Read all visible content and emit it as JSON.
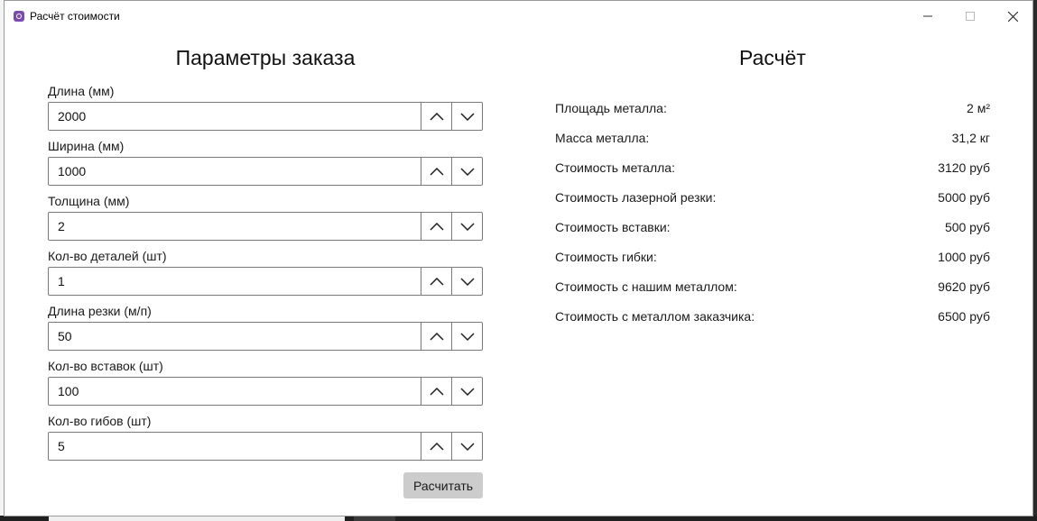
{
  "window": {
    "title": "Расчёт стоимости"
  },
  "params": {
    "heading": "Параметры заказа",
    "fields": [
      {
        "label": "Длина (мм)",
        "value": "2000"
      },
      {
        "label": "Ширина (мм)",
        "value": "1000"
      },
      {
        "label": "Толщина (мм)",
        "value": "2"
      },
      {
        "label": "Кол-во деталей (шт)",
        "value": "1"
      },
      {
        "label": "Длина резки (м/п)",
        "value": "50"
      },
      {
        "label": "Кол-во вставок (шт)",
        "value": "100"
      },
      {
        "label": "Кол-во гибов (шт)",
        "value": "5"
      }
    ],
    "calculate_label": "Расчитать"
  },
  "results": {
    "heading": "Расчёт",
    "rows": [
      {
        "label": "Площадь металла:",
        "value": "2 м²"
      },
      {
        "label": "Масса металла:",
        "value": "31,2 кг"
      },
      {
        "label": "Стоимость металла:",
        "value": "3120 руб"
      },
      {
        "label": "Стоимость лазерной резки:",
        "value": "5000 руб"
      },
      {
        "label": "Стоимость вставки:",
        "value": "500 руб"
      },
      {
        "label": "Стоимость гибки:",
        "value": "1000 руб"
      },
      {
        "label": "Стоимость с нашим металлом:",
        "value": "9620 руб"
      },
      {
        "label": "Стоимость с металлом заказчика:",
        "value": "6500 руб"
      }
    ]
  },
  "icons": {
    "app": "app-icon",
    "minimize": "minimize-icon",
    "maximize": "maximize-icon",
    "close": "close-icon",
    "up": "chevron-up-icon",
    "down": "chevron-down-icon"
  },
  "colors": {
    "accent": "#7a4ab0",
    "button_bg": "#cccccc",
    "border": "#7a7a7a"
  }
}
